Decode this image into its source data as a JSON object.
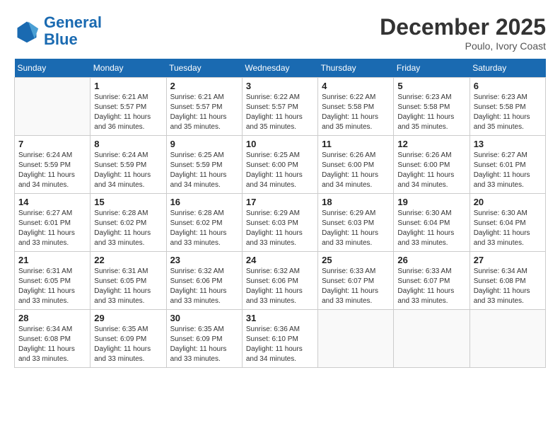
{
  "header": {
    "logo_general": "General",
    "logo_blue": "Blue",
    "month_title": "December 2025",
    "location": "Poulo, Ivory Coast"
  },
  "days_of_week": [
    "Sunday",
    "Monday",
    "Tuesday",
    "Wednesday",
    "Thursday",
    "Friday",
    "Saturday"
  ],
  "weeks": [
    [
      {
        "day": "",
        "info": ""
      },
      {
        "day": "1",
        "info": "Sunrise: 6:21 AM\nSunset: 5:57 PM\nDaylight: 11 hours\nand 36 minutes."
      },
      {
        "day": "2",
        "info": "Sunrise: 6:21 AM\nSunset: 5:57 PM\nDaylight: 11 hours\nand 35 minutes."
      },
      {
        "day": "3",
        "info": "Sunrise: 6:22 AM\nSunset: 5:57 PM\nDaylight: 11 hours\nand 35 minutes."
      },
      {
        "day": "4",
        "info": "Sunrise: 6:22 AM\nSunset: 5:58 PM\nDaylight: 11 hours\nand 35 minutes."
      },
      {
        "day": "5",
        "info": "Sunrise: 6:23 AM\nSunset: 5:58 PM\nDaylight: 11 hours\nand 35 minutes."
      },
      {
        "day": "6",
        "info": "Sunrise: 6:23 AM\nSunset: 5:58 PM\nDaylight: 11 hours\nand 35 minutes."
      }
    ],
    [
      {
        "day": "7",
        "info": "Sunrise: 6:24 AM\nSunset: 5:59 PM\nDaylight: 11 hours\nand 34 minutes."
      },
      {
        "day": "8",
        "info": "Sunrise: 6:24 AM\nSunset: 5:59 PM\nDaylight: 11 hours\nand 34 minutes."
      },
      {
        "day": "9",
        "info": "Sunrise: 6:25 AM\nSunset: 5:59 PM\nDaylight: 11 hours\nand 34 minutes."
      },
      {
        "day": "10",
        "info": "Sunrise: 6:25 AM\nSunset: 6:00 PM\nDaylight: 11 hours\nand 34 minutes."
      },
      {
        "day": "11",
        "info": "Sunrise: 6:26 AM\nSunset: 6:00 PM\nDaylight: 11 hours\nand 34 minutes."
      },
      {
        "day": "12",
        "info": "Sunrise: 6:26 AM\nSunset: 6:00 PM\nDaylight: 11 hours\nand 34 minutes."
      },
      {
        "day": "13",
        "info": "Sunrise: 6:27 AM\nSunset: 6:01 PM\nDaylight: 11 hours\nand 33 minutes."
      }
    ],
    [
      {
        "day": "14",
        "info": "Sunrise: 6:27 AM\nSunset: 6:01 PM\nDaylight: 11 hours\nand 33 minutes."
      },
      {
        "day": "15",
        "info": "Sunrise: 6:28 AM\nSunset: 6:02 PM\nDaylight: 11 hours\nand 33 minutes."
      },
      {
        "day": "16",
        "info": "Sunrise: 6:28 AM\nSunset: 6:02 PM\nDaylight: 11 hours\nand 33 minutes."
      },
      {
        "day": "17",
        "info": "Sunrise: 6:29 AM\nSunset: 6:03 PM\nDaylight: 11 hours\nand 33 minutes."
      },
      {
        "day": "18",
        "info": "Sunrise: 6:29 AM\nSunset: 6:03 PM\nDaylight: 11 hours\nand 33 minutes."
      },
      {
        "day": "19",
        "info": "Sunrise: 6:30 AM\nSunset: 6:04 PM\nDaylight: 11 hours\nand 33 minutes."
      },
      {
        "day": "20",
        "info": "Sunrise: 6:30 AM\nSunset: 6:04 PM\nDaylight: 11 hours\nand 33 minutes."
      }
    ],
    [
      {
        "day": "21",
        "info": "Sunrise: 6:31 AM\nSunset: 6:05 PM\nDaylight: 11 hours\nand 33 minutes."
      },
      {
        "day": "22",
        "info": "Sunrise: 6:31 AM\nSunset: 6:05 PM\nDaylight: 11 hours\nand 33 minutes."
      },
      {
        "day": "23",
        "info": "Sunrise: 6:32 AM\nSunset: 6:06 PM\nDaylight: 11 hours\nand 33 minutes."
      },
      {
        "day": "24",
        "info": "Sunrise: 6:32 AM\nSunset: 6:06 PM\nDaylight: 11 hours\nand 33 minutes."
      },
      {
        "day": "25",
        "info": "Sunrise: 6:33 AM\nSunset: 6:07 PM\nDaylight: 11 hours\nand 33 minutes."
      },
      {
        "day": "26",
        "info": "Sunrise: 6:33 AM\nSunset: 6:07 PM\nDaylight: 11 hours\nand 33 minutes."
      },
      {
        "day": "27",
        "info": "Sunrise: 6:34 AM\nSunset: 6:08 PM\nDaylight: 11 hours\nand 33 minutes."
      }
    ],
    [
      {
        "day": "28",
        "info": "Sunrise: 6:34 AM\nSunset: 6:08 PM\nDaylight: 11 hours\nand 33 minutes."
      },
      {
        "day": "29",
        "info": "Sunrise: 6:35 AM\nSunset: 6:09 PM\nDaylight: 11 hours\nand 33 minutes."
      },
      {
        "day": "30",
        "info": "Sunrise: 6:35 AM\nSunset: 6:09 PM\nDaylight: 11 hours\nand 33 minutes."
      },
      {
        "day": "31",
        "info": "Sunrise: 6:36 AM\nSunset: 6:10 PM\nDaylight: 11 hours\nand 34 minutes."
      },
      {
        "day": "",
        "info": ""
      },
      {
        "day": "",
        "info": ""
      },
      {
        "day": "",
        "info": ""
      }
    ]
  ]
}
